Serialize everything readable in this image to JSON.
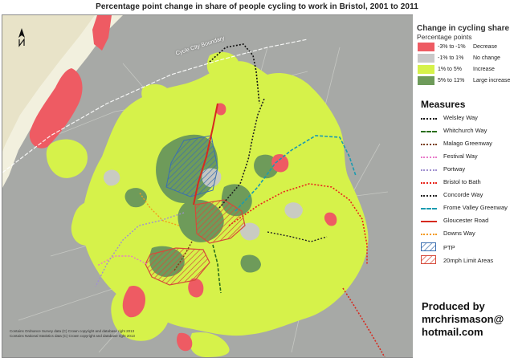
{
  "title": "Percentage point change in share of people cycling to work in Bristol, 2001 to 2011",
  "map": {
    "city_boundary_label": "Cycle City Boundary",
    "copyright_lines": [
      "Contains Ordnance Survey data (C) Crown copyright and database right 2013",
      "Contains National Statistics data (C) Crown copyright and database right 2013"
    ],
    "colors": {
      "background": "#a7a9a6",
      "sea": "#f3f1e1",
      "decrease": "#ee5b63",
      "no_change": "#c9c9c9",
      "increase": "#d6f24a",
      "large_increase": "#6e9b5a"
    }
  },
  "legend": {
    "change_title": "Change in cycling share",
    "change_subtitle": "Percentage points",
    "classes": [
      {
        "range": "-3% to -1%",
        "label": "Decrease",
        "color": "#ee5b63"
      },
      {
        "range": "-1% to 1%",
        "label": "No change",
        "color": "#c9c9c9"
      },
      {
        "range": "1% to 5%",
        "label": "Increase",
        "color": "#d6f24a"
      },
      {
        "range": "5% to 11%",
        "label": "Large increase",
        "color": "#6e9b5a"
      }
    ],
    "measures_title": "Measures",
    "measures": [
      {
        "label": "Welsley Way",
        "color": "#111111",
        "style": "dotted"
      },
      {
        "label": "Whitchurch Way",
        "color": "#2a6e1c",
        "style": "dashed"
      },
      {
        "label": "Malago Greenway",
        "color": "#7a3f18",
        "style": "dotted"
      },
      {
        "label": "Festival Way",
        "color": "#e879c9",
        "style": "dotted"
      },
      {
        "label": "Portway",
        "color": "#a090d0",
        "style": "dotted"
      },
      {
        "label": "Bristol to Bath",
        "color": "#e8251b",
        "style": "dotted"
      },
      {
        "label": "Concorde Way",
        "color": "#222222",
        "style": "dotted"
      },
      {
        "label": "Frome Valley Greenway",
        "color": "#1b9bb0",
        "style": "dashed"
      },
      {
        "label": "Gloucester Road",
        "color": "#d62a1f",
        "style": "solid"
      },
      {
        "label": "Downs Way",
        "color": "#f39a1d",
        "style": "dotted"
      }
    ],
    "areas": [
      {
        "label": "PTP",
        "color": "#3b6fb0",
        "pattern": "hatch-blue"
      },
      {
        "label": "20mph Limit Areas",
        "color": "#d64a3a",
        "pattern": "hatch-red"
      }
    ]
  },
  "credit": {
    "line1": "Produced by",
    "line2": "mrchrismason@",
    "line3": "hotmail.com"
  }
}
